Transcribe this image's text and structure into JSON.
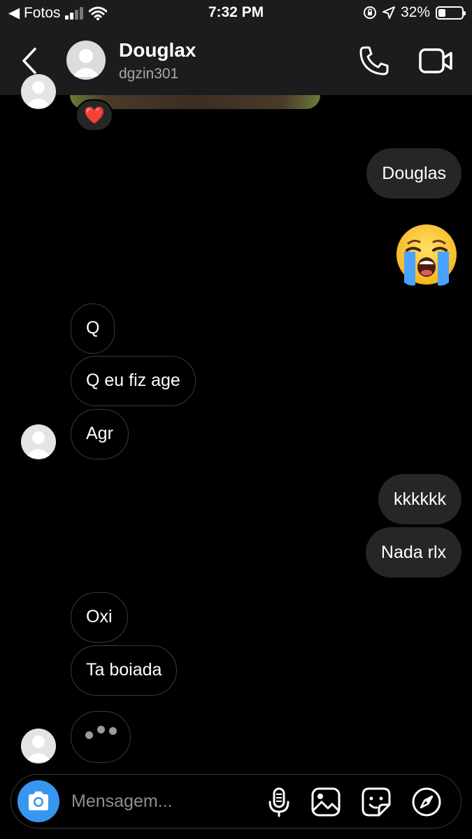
{
  "status_bar": {
    "back_app": "◀ Fotos",
    "time": "7:32 PM",
    "battery_percent": "32%",
    "battery_level": 0.32
  },
  "header": {
    "name": "Douglax",
    "username": "dgzin301"
  },
  "reaction_emoji": "❤️",
  "messages": [
    {
      "id": "m1",
      "side": "out",
      "text": "Douglas"
    },
    {
      "id": "m2",
      "side": "out",
      "type": "emoji",
      "emoji": "loudly-crying-face"
    },
    {
      "id": "m3",
      "side": "in",
      "text": "Q"
    },
    {
      "id": "m4",
      "side": "in",
      "text": "Q eu fiz age"
    },
    {
      "id": "m5",
      "side": "in",
      "text": "Agr"
    },
    {
      "id": "m6",
      "side": "out",
      "text": "kkkkkk"
    },
    {
      "id": "m7",
      "side": "out",
      "text": "Nada rlx"
    },
    {
      "id": "m8",
      "side": "in",
      "text": "Oxi"
    },
    {
      "id": "m9",
      "side": "in",
      "text": "Ta boiada"
    }
  ],
  "typing_indicator": true,
  "composer": {
    "placeholder": "Mensagem..."
  },
  "colors": {
    "accent": "#3797f0",
    "bubble_out": "#262626",
    "bubble_in_border": "#3a3a3c",
    "bar_bg": "#1c1c1e"
  }
}
